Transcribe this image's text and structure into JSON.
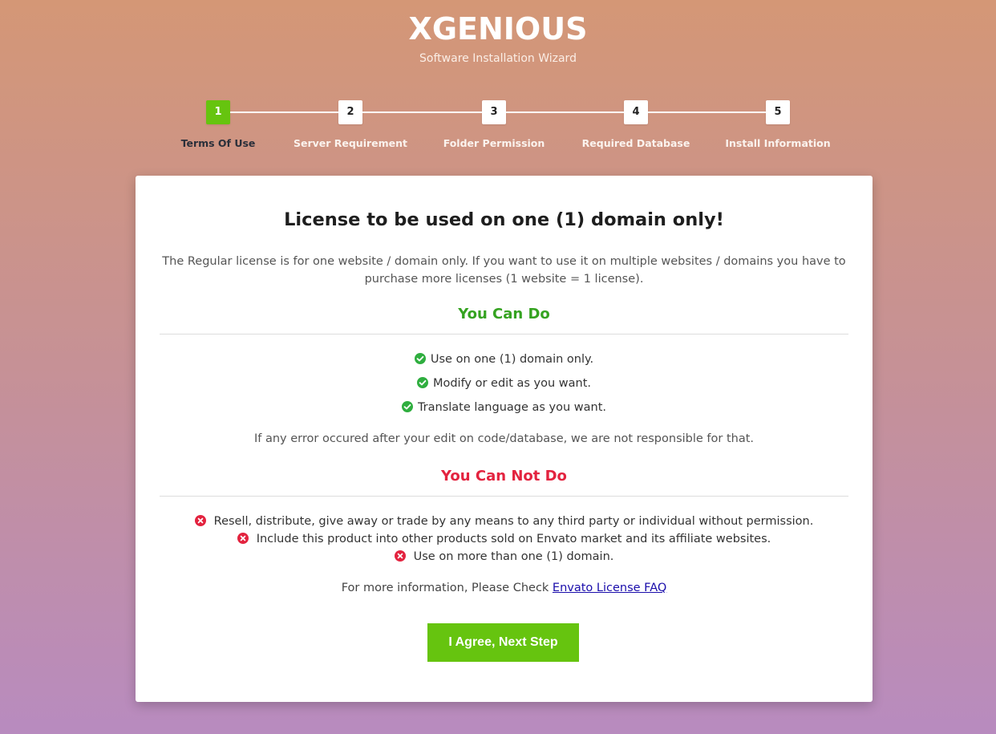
{
  "header": {
    "brand": "XGENIOUS",
    "subtitle": "Software Installation Wizard"
  },
  "steps": [
    {
      "number": "1",
      "label": "Terms Of Use",
      "active": true
    },
    {
      "number": "2",
      "label": "Server Requirement",
      "active": false
    },
    {
      "number": "3",
      "label": "Folder Permission",
      "active": false
    },
    {
      "number": "4",
      "label": "Required Database",
      "active": false
    },
    {
      "number": "5",
      "label": "Install Information",
      "active": false
    }
  ],
  "card": {
    "title": "License to be used on one (1) domain only!",
    "description": "The Regular license is for one website / domain only. If you want to use it on multiple websites / domains you have to purchase more licenses (1 website = 1 license).",
    "can_heading": "You Can Do",
    "can_items": [
      "Use on one (1) domain only.",
      "Modify or edit as you want.",
      "Translate language as you want."
    ],
    "note": "If any error occured after your edit on code/database, we are not responsible for that.",
    "cannot_heading": "You Can Not Do",
    "cannot_items": [
      "Resell, distribute, give away or trade by any means to any third party or individual without permission.",
      "Include this product into other products sold on Envato market and its affiliate websites.",
      "Use on more than one (1) domain."
    ],
    "more_info_prefix": "For more information, Please Check",
    "more_info_link": "Envato License FAQ",
    "agree_button": "I Agree, Next Step"
  },
  "colors": {
    "accent_green": "#66c40f",
    "can_green": "#35a321",
    "cannot_red": "#e3233f",
    "link_blue": "#1a0dab"
  },
  "icons": {
    "check": "check-circle-icon",
    "cross": "times-circle-icon"
  }
}
